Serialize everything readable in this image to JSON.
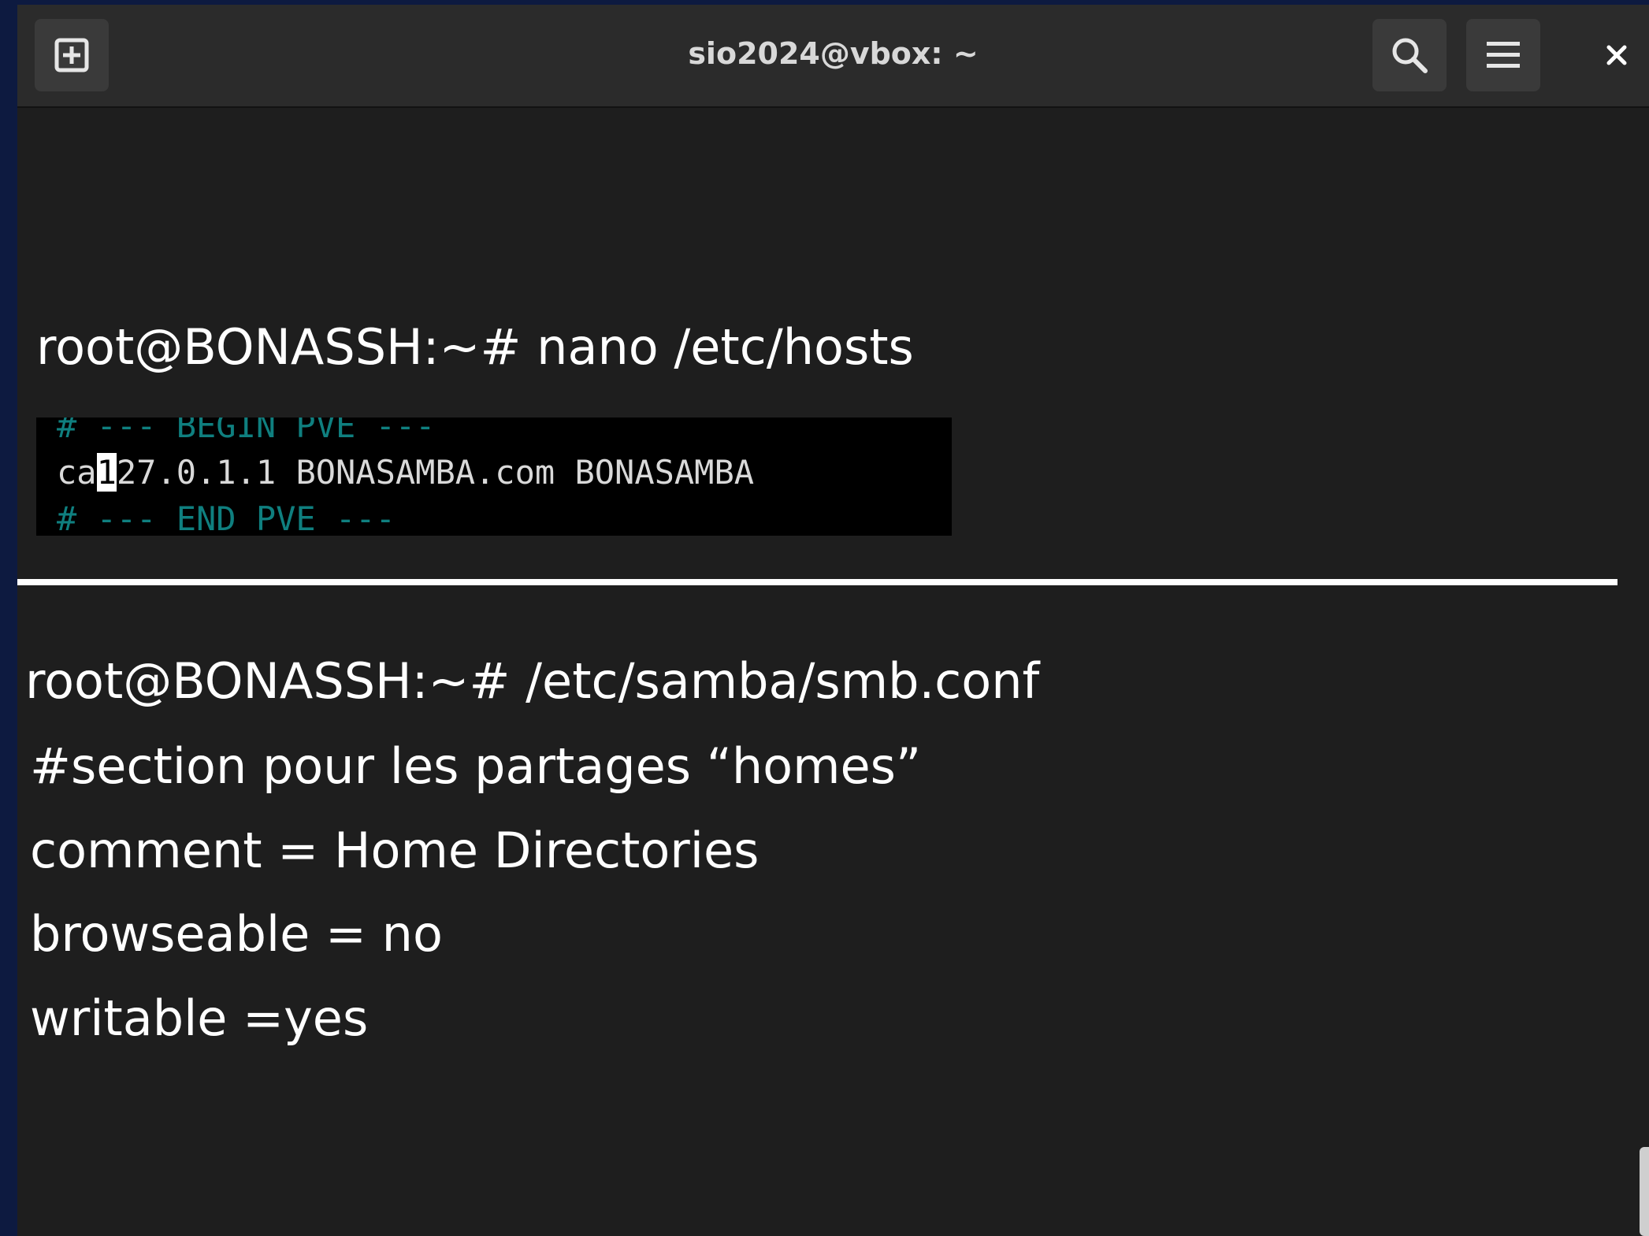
{
  "window": {
    "title": "sio2024@vbox: ~"
  },
  "toolbar": {
    "new_tab_icon": "new-tab-icon",
    "search_icon": "search-icon",
    "menu_icon": "hamburger-menu-icon",
    "close_icon": "close-icon"
  },
  "terminal": {
    "command1": "root@BONASSH:~# nano /etc/hosts",
    "hosts_file": {
      "line_begin": "# --- BEGIN PVE ---",
      "line_entry_prefix": "ca",
      "line_entry_cursor_char": "1",
      "line_entry_rest": "27.0.1.1 BONASAMBA.com BONASAMBA",
      "line_end": "# --- END PVE ---"
    },
    "command2": "root@BONASSH:~# /etc/samba/smb.conf",
    "smb_lines": [
      "#section pour les partages “homes”",
      "comment = Home Directories",
      "browseable = no",
      "writable =yes"
    ]
  },
  "colors": {
    "terminal_bg": "#1e1e1e",
    "titlebar_bg": "#2b2b2b",
    "desktop_bg": "#0d1a40",
    "comment_teal": "#0f7f7f"
  }
}
